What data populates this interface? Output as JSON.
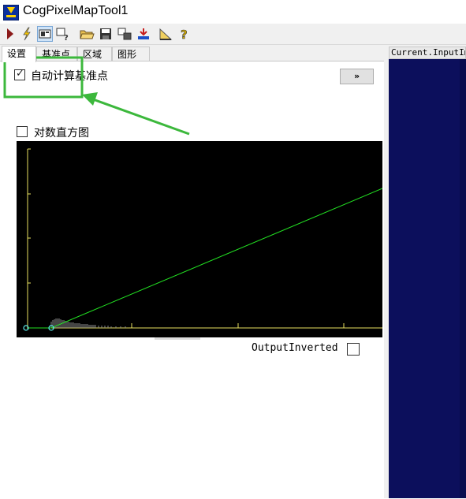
{
  "window": {
    "title": "CogPixelMapTool1"
  },
  "toolbar": {
    "buttons": [
      {
        "name": "run",
        "icon": "run-icon"
      },
      {
        "name": "electric",
        "icon": "lightning-icon"
      },
      {
        "name": "image-display",
        "icon": "image-display-icon"
      },
      {
        "name": "image-help",
        "icon": "image-help-icon"
      },
      {
        "name": "open",
        "icon": "open-folder-icon"
      },
      {
        "name": "save",
        "icon": "save-icon"
      },
      {
        "name": "reset",
        "icon": "reset-icon"
      },
      {
        "name": "import",
        "icon": "import-icon"
      },
      {
        "name": "measure",
        "icon": "measure-icon"
      },
      {
        "name": "help",
        "icon": "help-icon"
      }
    ]
  },
  "tabs": [
    {
      "label": "设置"
    },
    {
      "label": "基准点"
    },
    {
      "label": "区域"
    },
    {
      "label": "图形"
    }
  ],
  "settings": {
    "auto_compute_label": "自动计算基准点",
    "auto_compute_checked": true,
    "log_histogram_label": "对数直方图",
    "log_histogram_checked": false,
    "output_inverted_label": "OutputInverted",
    "output_inverted_checked": false,
    "expand_label": "»"
  },
  "right_panel": {
    "header": "Current.InputImage"
  },
  "colors": {
    "annotation": "#3cb83c",
    "mapping_line": "#22e022",
    "axis": "#e8e060",
    "image_bg": "#0c0f5c"
  }
}
